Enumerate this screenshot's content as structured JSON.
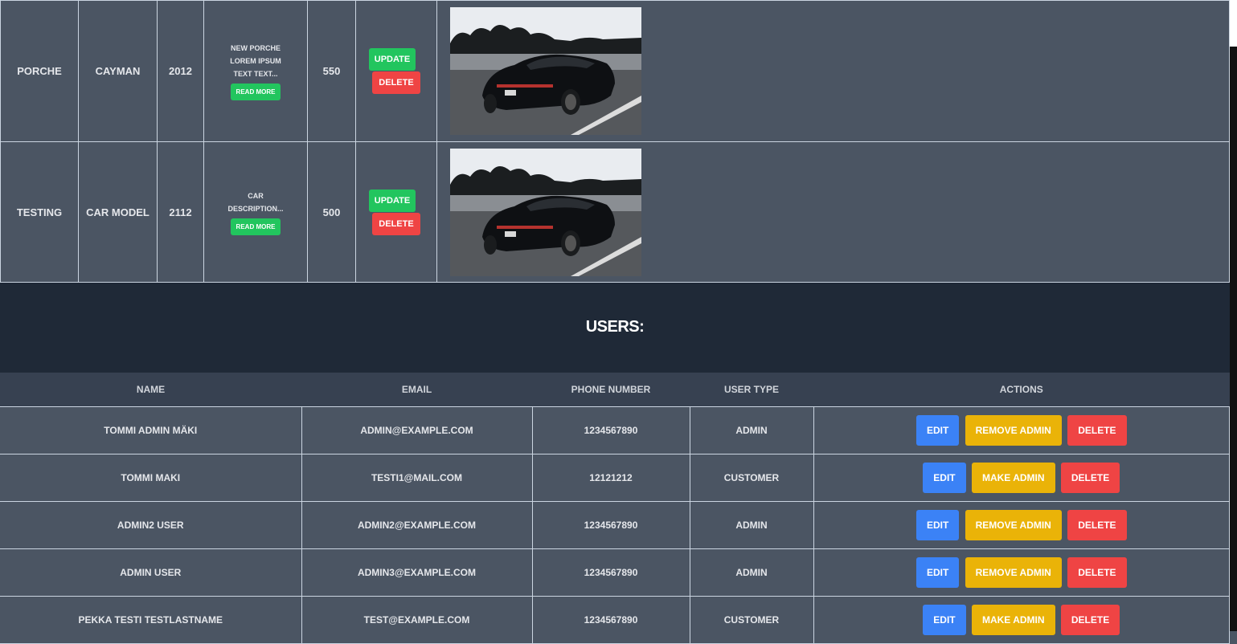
{
  "cars": [
    {
      "brand": "Porche",
      "model": "Cayman",
      "year": "2012",
      "description": "New porche lorem ipsum text text...",
      "read_more": "Read more",
      "price": "550",
      "update": "Update",
      "delete": "Delete"
    },
    {
      "brand": "Testing",
      "model": "Car model",
      "year": "2112",
      "description": "Car description...",
      "read_more": "Read more",
      "price": "500",
      "update": "Update",
      "delete": "Delete"
    }
  ],
  "users_section": {
    "title": "Users:",
    "columns": [
      "Name",
      "Email",
      "Phone number",
      "User type",
      "Actions"
    ],
    "rows": [
      {
        "name": "Tommi Admin Mäki",
        "email": "admin@example.com",
        "phone": "1234567890",
        "type": "Admin",
        "edit": "Edit",
        "toggle": "Remove admin",
        "delete": "Delete"
      },
      {
        "name": "Tommi Maki",
        "email": "testi1@mail.com",
        "phone": "12121212",
        "type": "Customer",
        "edit": "Edit",
        "toggle": "Make admin",
        "delete": "Delete"
      },
      {
        "name": "Admin2 User",
        "email": "admin2@example.com",
        "phone": "1234567890",
        "type": "Admin",
        "edit": "Edit",
        "toggle": "Remove admin",
        "delete": "Delete"
      },
      {
        "name": "Admin User",
        "email": "admin3@example.com",
        "phone": "1234567890",
        "type": "Admin",
        "edit": "Edit",
        "toggle": "Remove admin",
        "delete": "Delete"
      },
      {
        "name": "Pekka Testi Testlastname",
        "email": "test@example.com",
        "phone": "1234567890",
        "type": "Customer",
        "edit": "Edit",
        "toggle": "Make admin",
        "delete": "Delete"
      }
    ]
  },
  "colors": {
    "page_bg": "#4b5563",
    "section_bg": "#1f2937",
    "green": "#22c55e",
    "red": "#ef4444",
    "blue": "#3b82f6",
    "yellow": "#eab308"
  }
}
